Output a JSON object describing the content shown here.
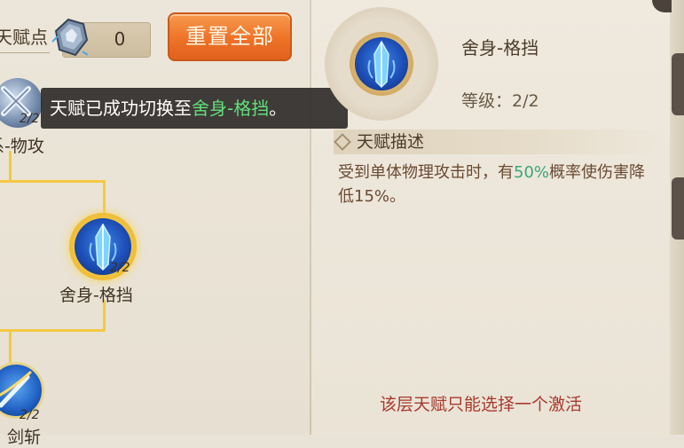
{
  "top_bar": {
    "talent_points_label": "天赋点",
    "talent_points_value": "0",
    "reset_all_label": "重置全部"
  },
  "tree": {
    "nodes": [
      {
        "level": "2/2",
        "name": "系-物攻",
        "icon": "crossed-swords-icon"
      },
      {
        "level": "2/2",
        "name": "舍身-格挡",
        "icon": "blue-crystal-icon",
        "selected": true
      },
      {
        "level": "2/2",
        "name": "剑斩",
        "icon": "sword-slash-icon"
      }
    ]
  },
  "toast": {
    "prefix": "天赋已成功切换至",
    "highlight": "舍身-格挡",
    "suffix": "。"
  },
  "detail": {
    "title": "舍身-格挡",
    "level_label": "等级：2/2",
    "description_header": "天赋描述",
    "description_part1": "受到单体物理攻击时，有",
    "description_pct": "50%",
    "description_part2": "概率使伤害降低15%。",
    "footer_note": "该层天赋只能选择一个激活"
  },
  "colors": {
    "highlight_green": "#62e07a",
    "percent_teal": "#38a77a",
    "note_red": "#a83a2e",
    "button_orange": "#ee7228",
    "tree_line_gold": "#f5c842"
  }
}
